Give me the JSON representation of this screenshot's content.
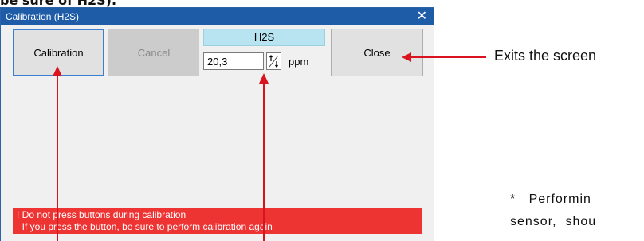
{
  "fragment_above": "be sure of H2S).",
  "window": {
    "title": "Calibration (H2S)",
    "close_glyph": "✕"
  },
  "buttons": {
    "calibration": "Calibration",
    "cancel": "Cancel",
    "close": "Close"
  },
  "gas": {
    "name": "H2S",
    "value": "20,3",
    "unit": "ppm"
  },
  "warning": {
    "line1": "! Do not press buttons during calibration",
    "line2": "  If you press the button, be sure to perform calibration again"
  },
  "annotations": {
    "exit": "Exits the screen",
    "note_line1": "*   Performin",
    "note_line2": "sensor,  shou"
  },
  "colors": {
    "arrow": "#d9141e",
    "titlebar": "#1f5ca8",
    "gas_box": "#b8e3f0",
    "warning": "#ee3333"
  }
}
